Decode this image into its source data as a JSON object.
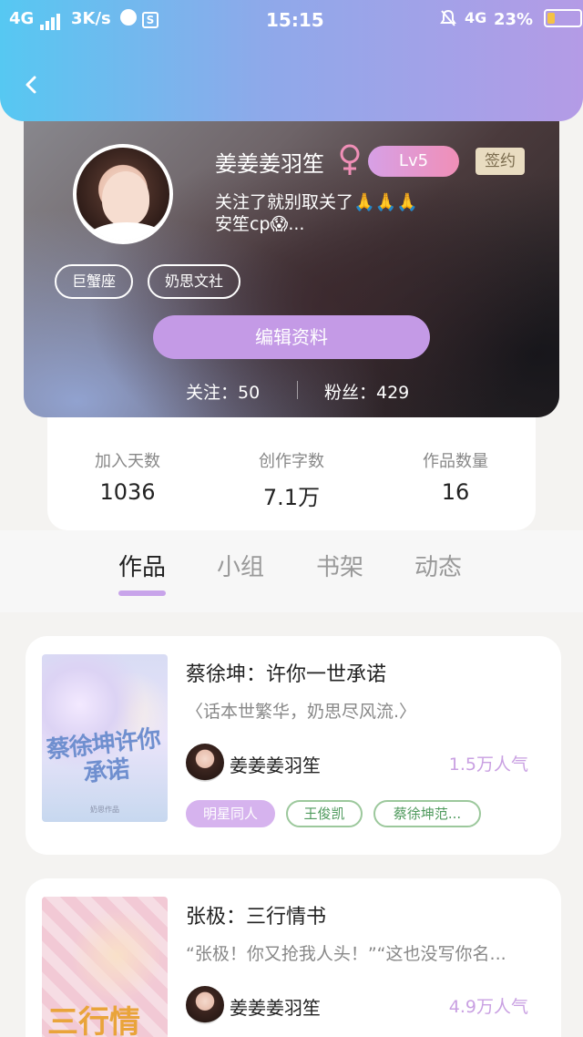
{
  "status_bar": {
    "network": "4G",
    "speed": "3K/s",
    "time": "15:15",
    "network2": "4G",
    "battery": "23%",
    "battery_level": 0.23
  },
  "profile": {
    "username": "姜姜姜羽笙",
    "level": "Lv5",
    "signed_badge": "签约",
    "bio_line1": "关注了就别取关了🙏🙏🙏",
    "bio_line2": "安笙cp😱...",
    "tags": [
      "巨蟹座",
      "奶思文社"
    ],
    "edit_button": "编辑资料",
    "following_label": "关注：50",
    "followers_label": "粉丝：429"
  },
  "stats": [
    {
      "label": "加入天数",
      "value": "1036"
    },
    {
      "label": "创作字数",
      "value": "7.1万"
    },
    {
      "label": "作品数量",
      "value": "16"
    }
  ],
  "tabs": [
    "作品",
    "小组",
    "书架",
    "动态"
  ],
  "active_tab": "作品",
  "books": [
    {
      "title": "蔡徐坤：许你一世承诺",
      "description": "〈话本世繁华，奶思尽风流.〉",
      "author": "姜姜姜羽笙",
      "popularity": "1.5万人气",
      "cover_title": "蔡徐坤许你承诺",
      "cover_brand": "奶思作品",
      "tags": [
        "明星同人",
        "王俊凯",
        "蔡徐坤范..."
      ]
    },
    {
      "title": "张极：三行情书",
      "description": "“张极！你又抢我人头！”“这也没写你名...",
      "author": "姜姜姜羽笙",
      "popularity": "4.9万人气",
      "cover_title": "三行情书"
    }
  ],
  "colors": {
    "header_gradient_start": "#56c8f2",
    "header_gradient_end": "#b49be6",
    "accent_purple": "#c49ae6",
    "tag_green": "#4f9a5d"
  },
  "icons": {
    "back": "chevron-left-icon",
    "gender": "female-icon"
  }
}
